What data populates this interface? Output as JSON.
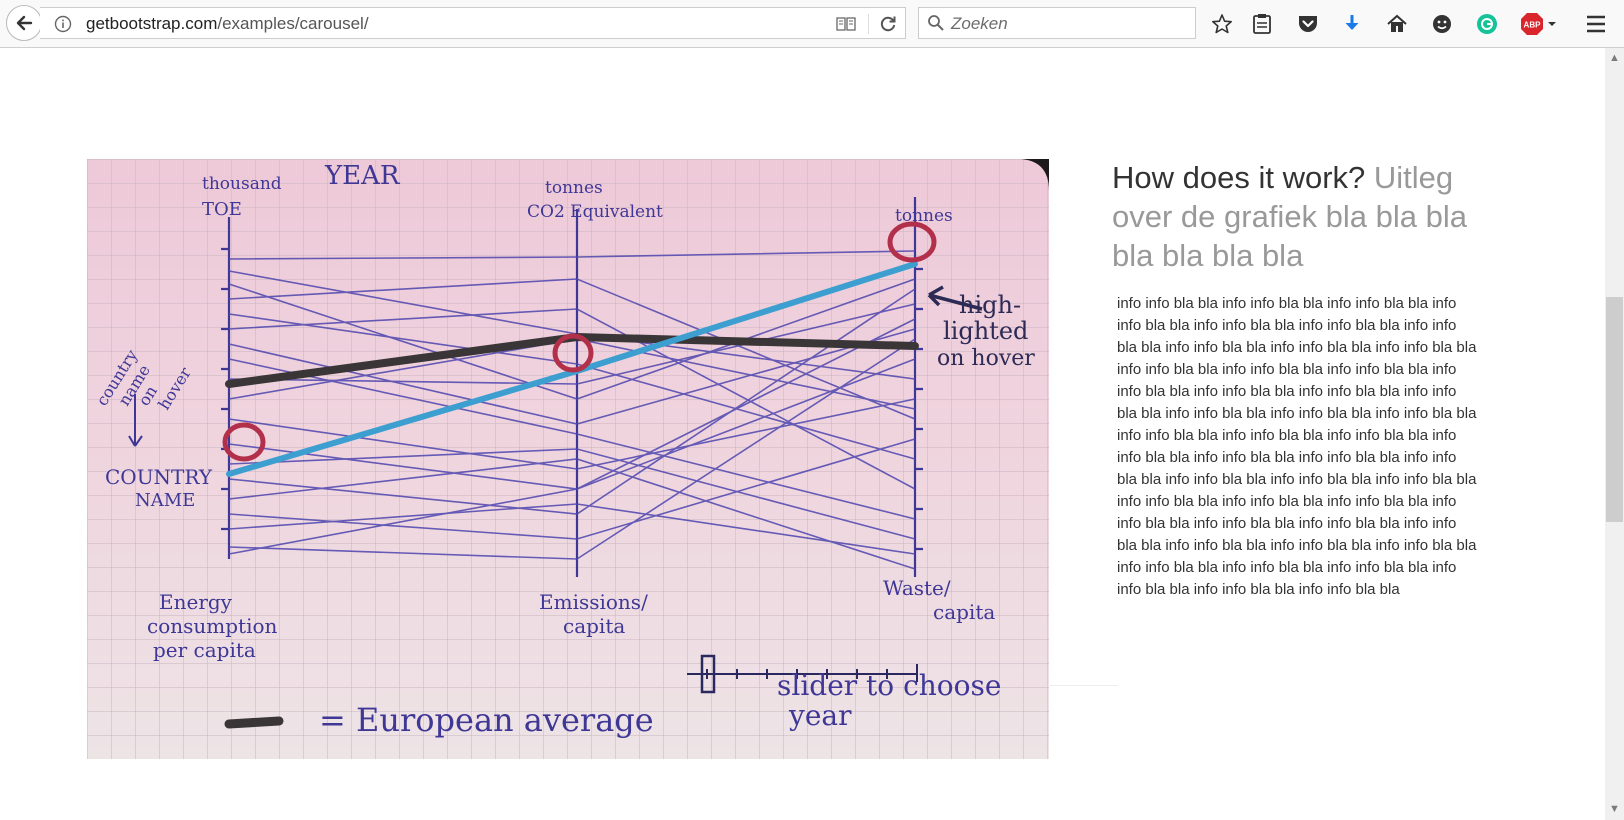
{
  "browser": {
    "url_domain": "getbootstrap.com",
    "url_path": "/examples/carousel/",
    "search_placeholder": "Zoeken",
    "toolbar_icons": [
      "bookmark-star-icon",
      "reading-list-icon",
      "pocket-icon",
      "downloads-icon",
      "home-icon",
      "emoji-icon",
      "grammarly-icon",
      "adblock-plus-icon",
      "hamburger-menu-icon"
    ],
    "abp_label": "ABP"
  },
  "featurette": {
    "heading": "How does it work?",
    "heading_muted": "Uitleg over de grafiek bla bla bla bla bla bla bla",
    "body": "info info bla bla info info bla bla info info bla bla info info bla bla info info bla bla info info bla bla info info bla bla info info bla bla info info bla bla info info bla bla info info bla bla info info bla bla info info bla bla info info bla bla info info bla bla info info bla bla info info bla bla info info bla bla info info bla bla info info bla bla info info bla bla info info bla bla info info bla bla info info bla bla info info bla bla info info bla bla info info bla bla info info bla bla info info bla bla info info bla bla info info bla bla info info bla bla info info bla bla info info bla bla info info bla bla info info bla bla info info bla bla info info bla bla info info bla bla info info bla bla info info bla bla info info bla bla info info bla bla info info bla bla info info bla bla info info bla bla"
  },
  "sketch": {
    "year_label": "YEAR",
    "axis1_unit_1": "thousand",
    "axis1_unit_2": "TOE",
    "axis2_unit_1": "tonnes",
    "axis2_unit_2": "CO2 Equivalent",
    "axis3_unit": "tonnes",
    "axis1_label_1": "Energy",
    "axis1_label_2": "consumption",
    "axis1_label_3": "per capita",
    "axis2_label_1": "Emissions/",
    "axis2_label_2": "capita",
    "axis3_label_1": "Waste/",
    "axis3_label_2": "capita",
    "country_hover_1": "country",
    "country_hover_2": "name",
    "country_hover_3": "on",
    "country_hover_4": "hover",
    "country_name_1": "COUNTRY",
    "country_name_2": "NAME",
    "highlight_1": "high-",
    "highlight_2": "lighted",
    "highlight_3": "on hover",
    "slider_1": "slider to choose",
    "slider_2": "year",
    "legend": "= European average"
  }
}
